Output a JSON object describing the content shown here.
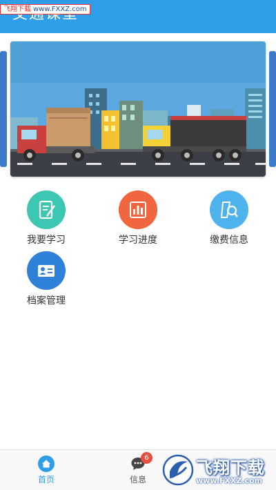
{
  "header": {
    "title": "交通课堂"
  },
  "watermark_top": {
    "label": "飞翔下载",
    "url": "www.FXXZ.com"
  },
  "banner": {
    "image": "delivery-truck-city-illustration"
  },
  "grid": [
    {
      "label": "我要学习",
      "icon": "notebook-icon",
      "color": "#3cc7b3"
    },
    {
      "label": "学习进度",
      "icon": "bar-chart-icon",
      "color": "#f0653d"
    },
    {
      "label": "缴费信息",
      "icon": "search-document-icon",
      "color": "#4eb2ec"
    },
    {
      "label": "档案管理",
      "icon": "id-card-icon",
      "color": "#2f80d8"
    }
  ],
  "bottom_nav": {
    "items": [
      {
        "label": "首页",
        "icon": "home-icon",
        "active": true
      },
      {
        "label": "信息",
        "icon": "chat-icon",
        "badge": "6",
        "active": false
      }
    ]
  },
  "watermark_logo": {
    "text": "飞翔下载",
    "url": "www.FXXZ.com"
  },
  "colors": {
    "primary": "#2f9ee8",
    "badge": "#e94e3e"
  }
}
